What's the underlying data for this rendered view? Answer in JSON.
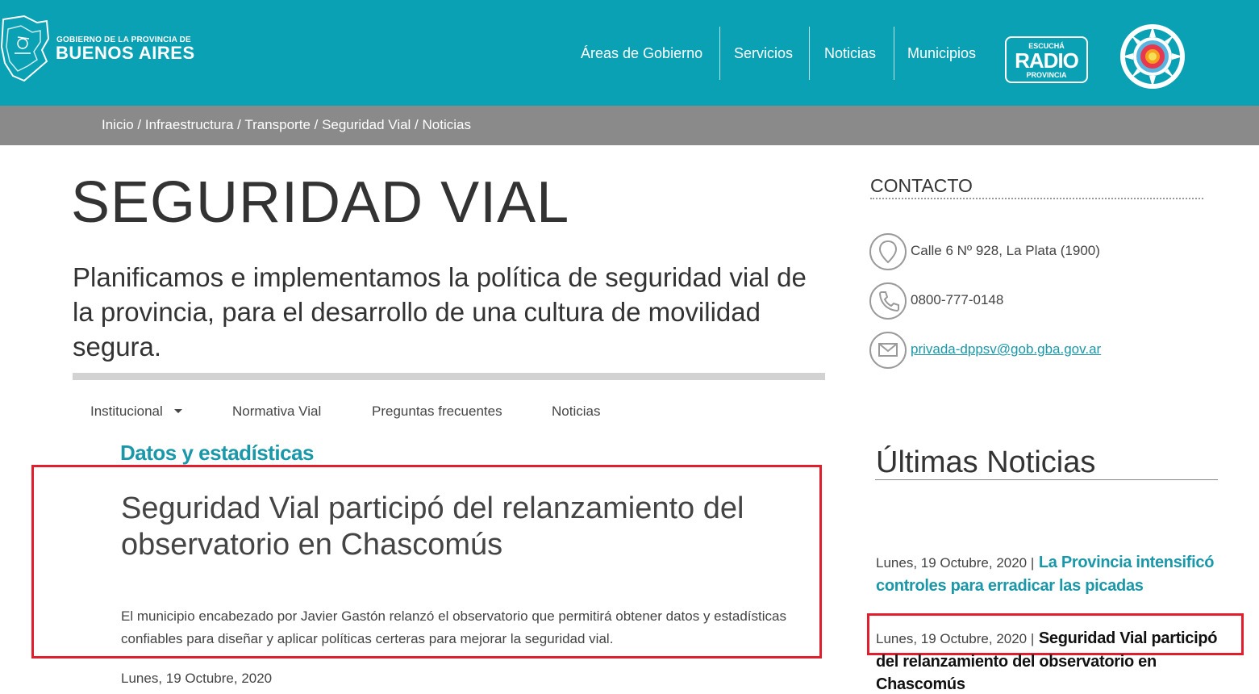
{
  "header": {
    "logo_small": "GOBIERNO DE LA PROVINCIA DE",
    "logo_big": "BUENOS AIRES",
    "nav": [
      "Áreas de Gobierno",
      "Servicios",
      "Noticias",
      "Municipios"
    ],
    "radio": {
      "top": "ESCUCHÁ",
      "mid": "RADIO",
      "bot": "PROVINCIA"
    },
    "accent_color": "#0aa1b4"
  },
  "breadcrumb": "Inicio / Infraestructura / Transporte / Seguridad Vial / Noticias",
  "main": {
    "title": "SEGURIDAD VIAL",
    "lead": "Planificamos e implementamos la política de seguridad vial de la provincia, para el desarrollo de una cultura de movilidad segura.",
    "subnav": [
      "Institucional",
      "Normativa Vial",
      "Preguntas frecuentes",
      "Noticias"
    ],
    "section_title": "Datos y estadísticas",
    "article": {
      "title": "Seguridad Vial participó del relanzamiento del observatorio en Chascomús",
      "body": "El municipio encabezado por Javier Gastón relanzó el observatorio que permitirá obtener datos y estadísticas confiables para diseñar y aplicar políticas certeras para mejorar la seguridad vial.",
      "date": "Lunes, 19 Octubre, 2020"
    }
  },
  "sidebar": {
    "contact_head": "CONTACTO",
    "address": "Calle 6 Nº 928, La Plata (1900)",
    "phone": "0800-777-0148",
    "email": "privada-dppsv@gob.gba.gov.ar",
    "news_head": "Últimas Noticias",
    "news": [
      {
        "date": "Lunes, 19 Octubre, 2020 |",
        "title": "La Provincia intensificó controles para erradicar las picadas"
      },
      {
        "date": "Lunes, 19 Octubre, 2020 |",
        "title": "Seguridad Vial participó del relanzamiento del observatorio en Chascomús"
      }
    ]
  },
  "highlight_color": "#e01e2d"
}
